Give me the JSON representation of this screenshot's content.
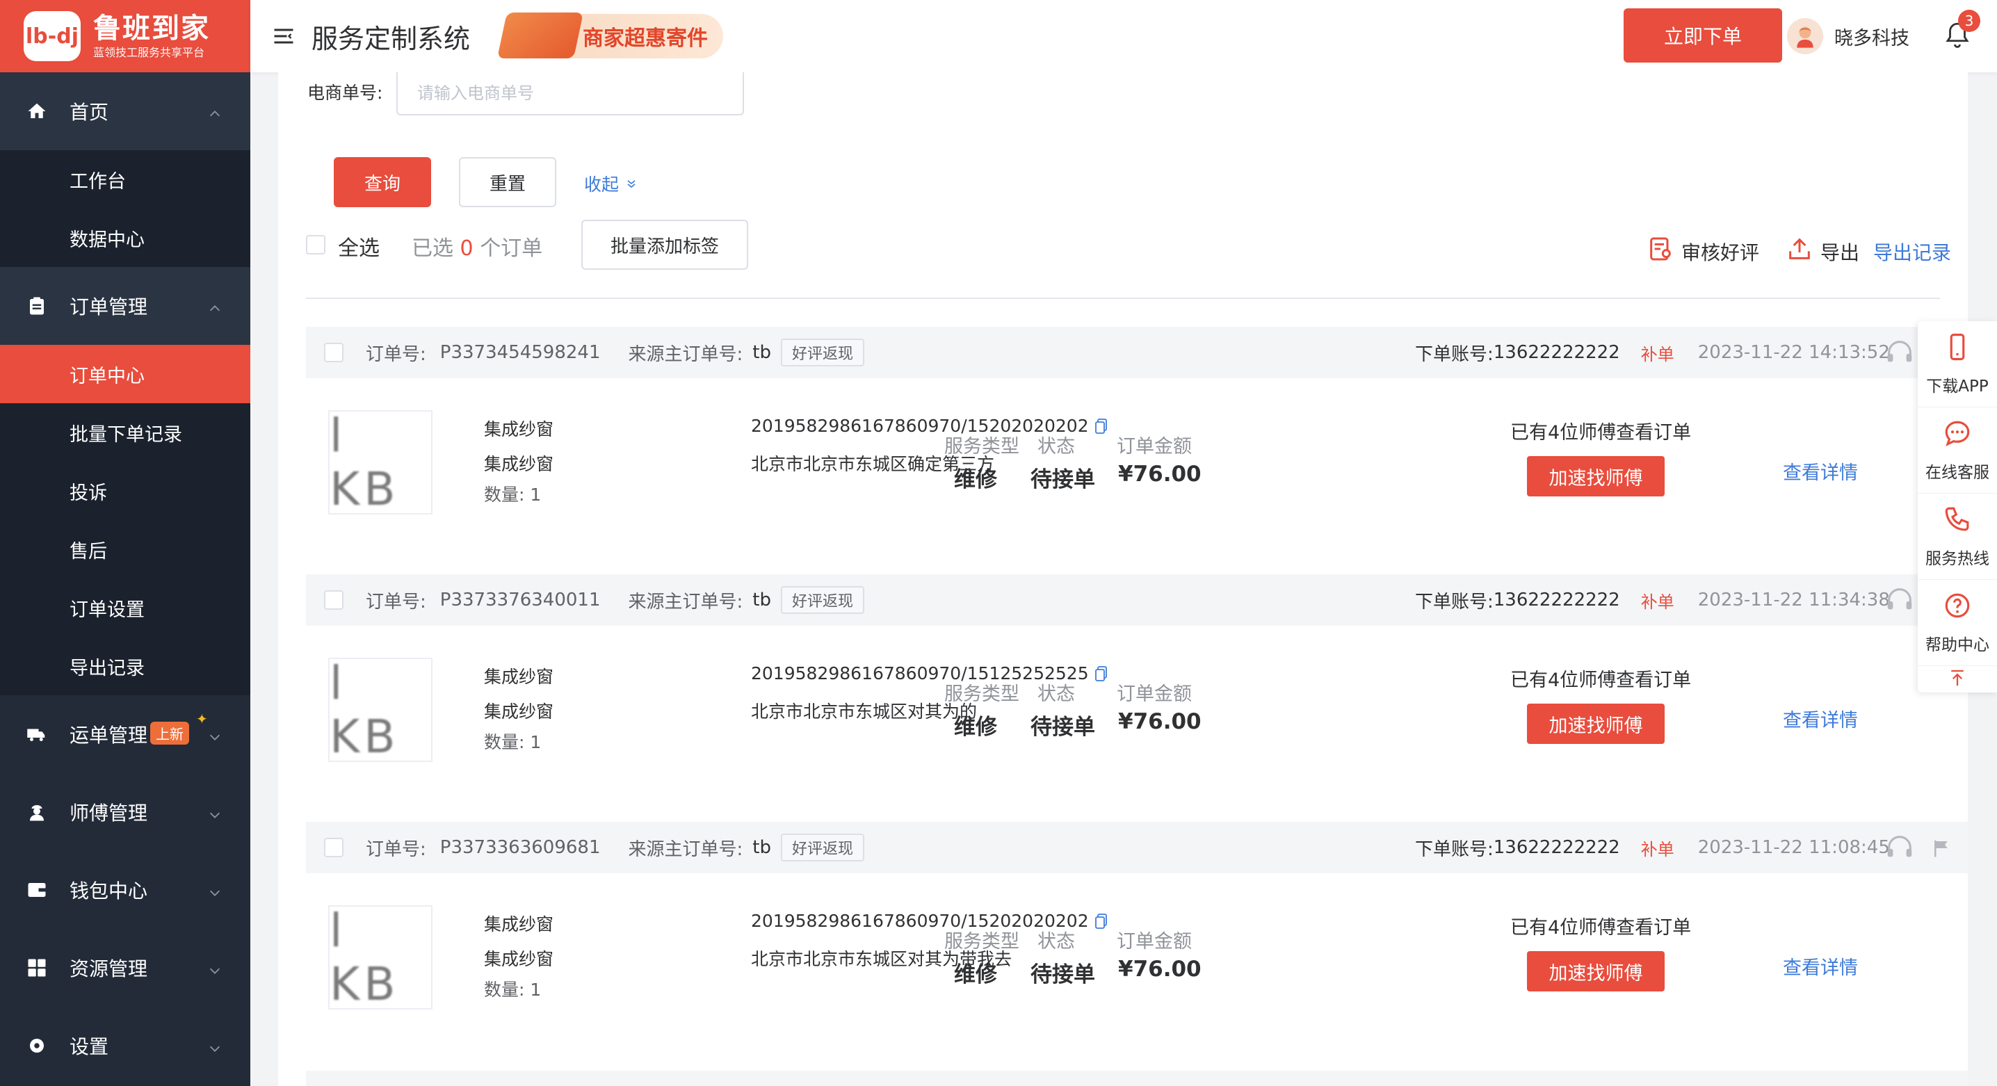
{
  "brand": {
    "logo_mark": "lb-dj",
    "title": "鲁班到家",
    "subtitle": "蓝领技工服务共享平台"
  },
  "sidebar": {
    "home": "首页",
    "home_items": [
      "工作台",
      "数据中心"
    ],
    "orders": "订单管理",
    "order_items": [
      "订单中心",
      "批量下单记录",
      "投诉",
      "售后",
      "订单设置",
      "导出记录"
    ],
    "waybill": "运单管理",
    "waybill_badge": "上新",
    "masters": "师傅管理",
    "wallet": "钱包中心",
    "resources": "资源管理",
    "settings": "设置"
  },
  "header": {
    "title": "服务定制系统",
    "promo": "商家超惠寄件",
    "order_now": "立即下单",
    "user_name": "晓多科技",
    "notif_count": "3"
  },
  "filter": {
    "ecom_label": "电商单号:",
    "ecom_placeholder": "请输入电商单号",
    "query": "查询",
    "reset": "重置",
    "collapse": "收起",
    "select_all": "全选",
    "selected_prefix": "已选",
    "selected_count": "0",
    "selected_suffix": "个订单",
    "batch_tag": "批量添加标签",
    "audit_review": "审核好评",
    "export": "导出",
    "export_records": "导出记录"
  },
  "labels": {
    "order_no": "订单号:",
    "source_order": "来源主订单号:",
    "account": "下单账号:",
    "service_type": "服务类型",
    "status": "状态",
    "amount": "订单金额",
    "speed_up": "加速找师傅",
    "view_detail": "查看详情"
  },
  "orders": [
    {
      "order_no": "P3373454598241",
      "source": "tb",
      "tag": "好评返现",
      "account": "13622222222",
      "supp": "补单",
      "time": "2023-11-22 14:13:52",
      "thumb": "l KB",
      "product": "集成纱窗",
      "product2": "集成纱窗",
      "qty": "数量: 1",
      "ecom_no": "2019582986167860970/15202020202",
      "address": "北京市北京市东城区确定第三方",
      "service_type": "维修",
      "status": "待接单",
      "amount": "¥76.00",
      "masters_note": "已有4位师傅查看订单"
    },
    {
      "order_no": "P3373376340011",
      "source": "tb",
      "tag": "好评返现",
      "account": "13622222222",
      "supp": "补单",
      "time": "2023-11-22 11:34:38",
      "thumb": "l KB",
      "product": "集成纱窗",
      "product2": "集成纱窗",
      "qty": "数量: 1",
      "ecom_no": "2019582986167860970/15125252525",
      "address": "北京市北京市东城区对其为的",
      "service_type": "维修",
      "status": "待接单",
      "amount": "¥76.00",
      "masters_note": "已有4位师傅查看订单"
    },
    {
      "order_no": "P3373363609681",
      "source": "tb",
      "tag": "好评返现",
      "account": "13622222222",
      "supp": "补单",
      "time": "2023-11-22 11:08:45",
      "thumb": "l KB",
      "product": "集成纱窗",
      "product2": "集成纱窗",
      "qty": "数量: 1",
      "ecom_no": "2019582986167860970/15202020202",
      "address": "北京市北京市东城区对其为带我去",
      "service_type": "维修",
      "status": "待接单",
      "amount": "¥76.00",
      "masters_note": "已有4位师傅查看订单"
    }
  ],
  "float_bar": {
    "download_app": "下载APP",
    "online_cs": "在线客服",
    "hotline": "服务热线",
    "help": "帮助中心"
  },
  "colors": {
    "accent": "#e84d3d",
    "sidebar_bg": "#232b38",
    "link": "#3e7bd8"
  },
  "icons": [
    "home-icon",
    "clipboard-icon",
    "truck-icon",
    "worker-icon",
    "wallet-icon",
    "grid-icon",
    "gear-icon",
    "menu-icon",
    "bell-icon",
    "copy-icon",
    "headset-icon",
    "flag-icon",
    "phone-icon",
    "chat-icon",
    "call-icon",
    "help-icon",
    "arrow-up-icon",
    "review-icon",
    "export-icon"
  ]
}
